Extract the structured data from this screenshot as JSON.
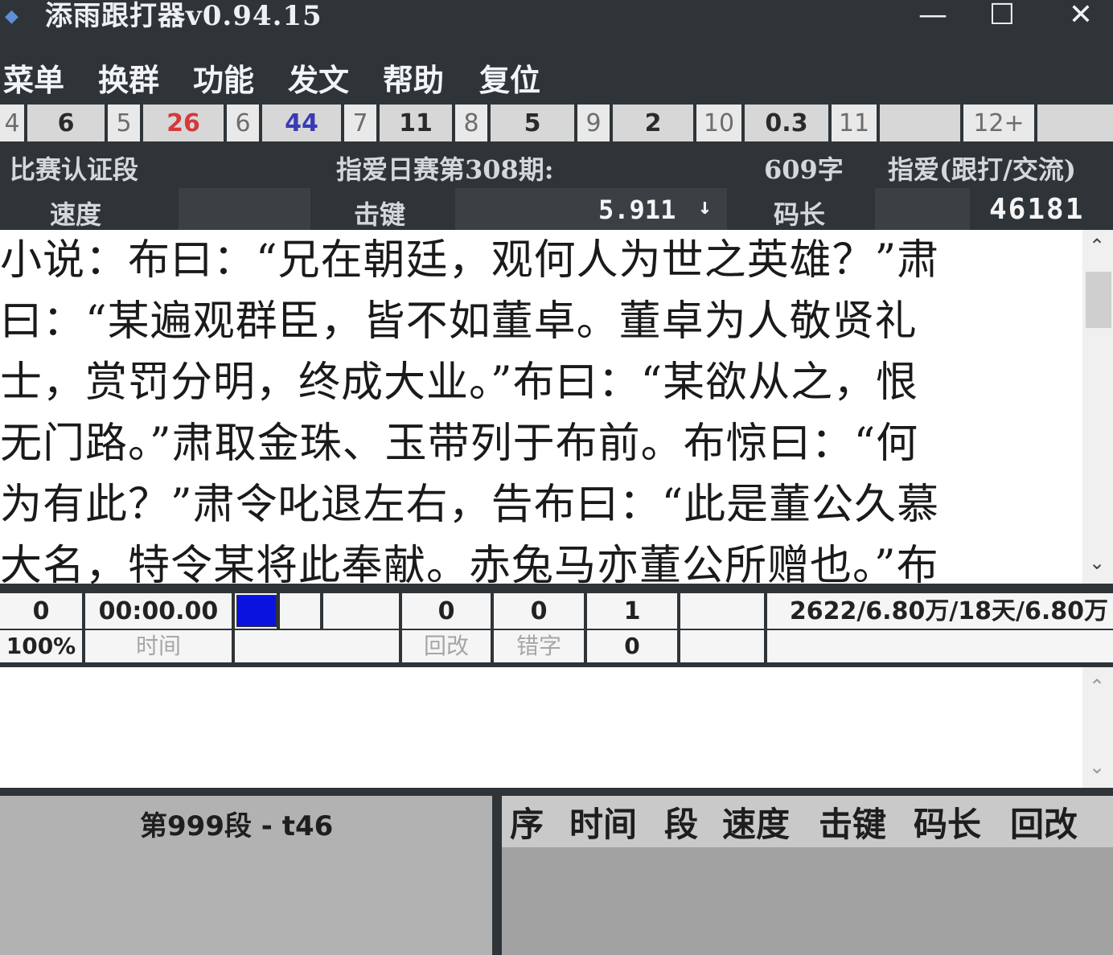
{
  "window": {
    "title": "添雨跟打器v0.94.15",
    "minimize": "—",
    "maximize": "☐",
    "close": "✕"
  },
  "menu": [
    "菜单",
    "换群",
    "功能",
    "发文",
    "帮助",
    "复位"
  ],
  "strip": [
    {
      "idx": "4",
      "val": "6",
      "color": "#2a2a2a"
    },
    {
      "idx": "5",
      "val": "26",
      "color": "#d43a3a"
    },
    {
      "idx": "6",
      "val": "44",
      "color": "#3b3bb5"
    },
    {
      "idx": "7",
      "val": "11",
      "color": "#2a2a2a"
    },
    {
      "idx": "8",
      "val": "5",
      "color": "#2a2a2a"
    },
    {
      "idx": "9",
      "val": "2",
      "color": "#2a2a2a"
    },
    {
      "idx": "10",
      "val": "0.3",
      "color": "#2a2a2a"
    },
    {
      "idx": "11",
      "val": "",
      "color": "#2a2a2a"
    },
    {
      "idx": "12+",
      "val": "",
      "color": "#2a2a2a"
    }
  ],
  "info": {
    "section": "比赛认证段",
    "match": "指爱日赛第308期:",
    "chars": "609字",
    "group": "指爱(跟打/交流)",
    "speed_label": "速度",
    "keystroke_label": "击键",
    "keystroke_value": "5.911",
    "keystroke_arrow": "↓",
    "codelen_label": "码长",
    "code_value": "46181"
  },
  "article_lines": [
    "小说：布曰：“兄在朝廷，观何人为世之英雄？”肃",
    "曰：“某遍观群臣，皆不如董卓。董卓为人敬贤礼",
    "士，赏罚分明，终成大业。”布曰：“某欲从之，恨",
    "无门路。”肃取金珠、玉带列于布前。布惊曰：“何",
    "为有此？”肃令叱退左右，告布曰：“此是董公久慕",
    "大名，特令某将此奉献。赤兔马亦董公所赠也。”布"
  ],
  "status": {
    "count": "0",
    "percent": "100%",
    "time": "00:00.00",
    "time_label": "时间",
    "backspace": "0",
    "backspace_label": "回改",
    "errors": "0",
    "errors_label": "错字",
    "v1": "1",
    "v2": "0",
    "progress": "2622/6.80万/18天/6.80万"
  },
  "bottom": {
    "segment": "第999段 - t46",
    "columns": [
      "序",
      "时间",
      "段",
      "速度",
      "击键",
      "码长",
      "回改"
    ]
  },
  "colors": {
    "accent_blue": "#0a12e0",
    "dark_bg": "#2f3438"
  }
}
